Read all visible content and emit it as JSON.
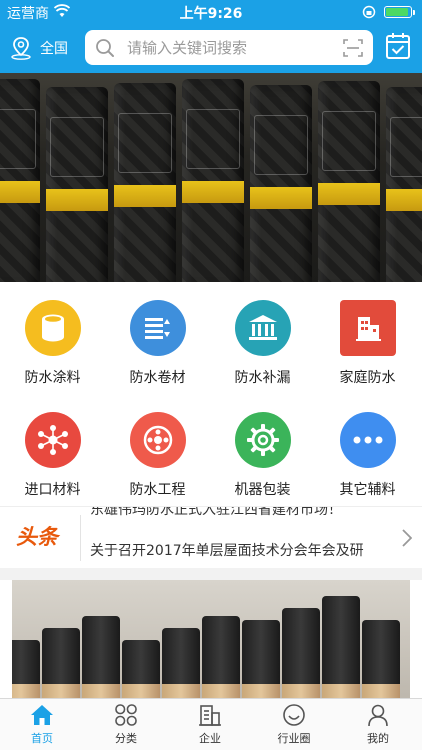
{
  "status_bar": {
    "carrier": "运营商",
    "time": "上午9:26",
    "battery_level": 0.9
  },
  "header": {
    "location": "全国",
    "search": {
      "placeholder": "请输入关键词搜索",
      "value": ""
    },
    "icons": [
      "location-icon",
      "search-icon",
      "scan-icon",
      "calendar-check-icon"
    ],
    "accent_color": "#1ba1e6"
  },
  "banner": {
    "slides": 4,
    "active_slide": 2
  },
  "categories": [
    {
      "label": "防水涂料",
      "icon": "paint-can-icon",
      "color": "#f5bd1f"
    },
    {
      "label": "防水卷材",
      "icon": "list-roll-icon",
      "color": "#3e8fdc"
    },
    {
      "label": "防水补漏",
      "icon": "building-columns-icon",
      "color": "#27a3b5"
    },
    {
      "label": "家庭防水",
      "icon": "house-icon",
      "color": "#e24b3b"
    },
    {
      "label": "进口材料",
      "icon": "share-network-icon",
      "color": "#e8493f"
    },
    {
      "label": "防水工程",
      "icon": "gear-wheel-icon",
      "color": "#ef5a4b"
    },
    {
      "label": "机器包装",
      "icon": "gear-icon",
      "color": "#3bb45a"
    },
    {
      "label": "其它辅料",
      "icon": "more-dots-icon",
      "color": "#3f8ef0"
    }
  ],
  "news": {
    "tag": "头条",
    "items": [
      "东雄伟玛防水正式入驻江西省建材市场！",
      "关于召开2017年单层屋面技术分会年会及研"
    ]
  },
  "tabbar": [
    {
      "label": "首页",
      "icon": "home-icon",
      "active": true
    },
    {
      "label": "分类",
      "icon": "category-grid-icon",
      "active": false
    },
    {
      "label": "企业",
      "icon": "company-building-icon",
      "active": false
    },
    {
      "label": "行业圈",
      "icon": "smile-circle-icon",
      "active": false
    },
    {
      "label": "我的",
      "icon": "user-icon",
      "active": false
    }
  ]
}
